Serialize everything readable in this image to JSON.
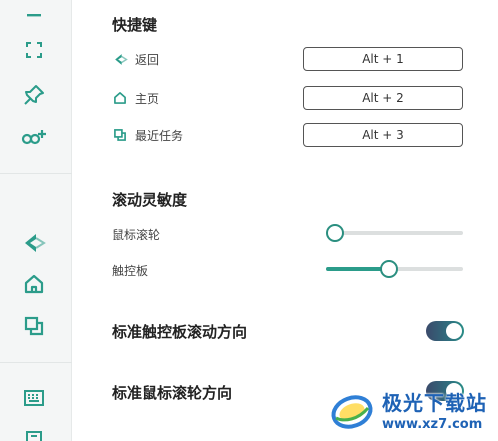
{
  "colors": {
    "accent": "#2b9c8a",
    "sidebar_bg": "#f4f6f6",
    "toggle_on": "#2a8d87"
  },
  "sidebar": {
    "items": [
      {
        "icon": "minimize-icon"
      },
      {
        "icon": "fullscreen-icon"
      },
      {
        "icon": "pin-icon"
      },
      {
        "icon": "add-link-icon"
      },
      {
        "icon": "back-icon"
      },
      {
        "icon": "home-icon"
      },
      {
        "icon": "recent-tasks-icon"
      },
      {
        "icon": "keyboard-icon"
      },
      {
        "icon": "more-icon"
      }
    ]
  },
  "shortcuts": {
    "title": "快捷键",
    "items": [
      {
        "icon": "back-icon",
        "label": "返回",
        "key": "Alt + 1"
      },
      {
        "icon": "home-icon",
        "label": "主页",
        "key": "Alt + 2"
      },
      {
        "icon": "recent-tasks-icon",
        "label": "最近任务",
        "key": "Alt + 3"
      }
    ]
  },
  "scroll_sensitivity": {
    "title": "滚动灵敏度",
    "mouse_wheel": {
      "label": "鼠标滚轮",
      "value_fraction": 0.0
    },
    "touchpad": {
      "label": "触控板",
      "value_fraction": 0.45
    }
  },
  "toggles": {
    "touchpad_direction": {
      "label": "标准触控板滚动方向",
      "on": true
    },
    "mouse_direction": {
      "label": "标准鼠标滚轮方向",
      "on": true
    }
  },
  "watermark": {
    "name": "极光下载站",
    "url": "www.xz7.com"
  }
}
